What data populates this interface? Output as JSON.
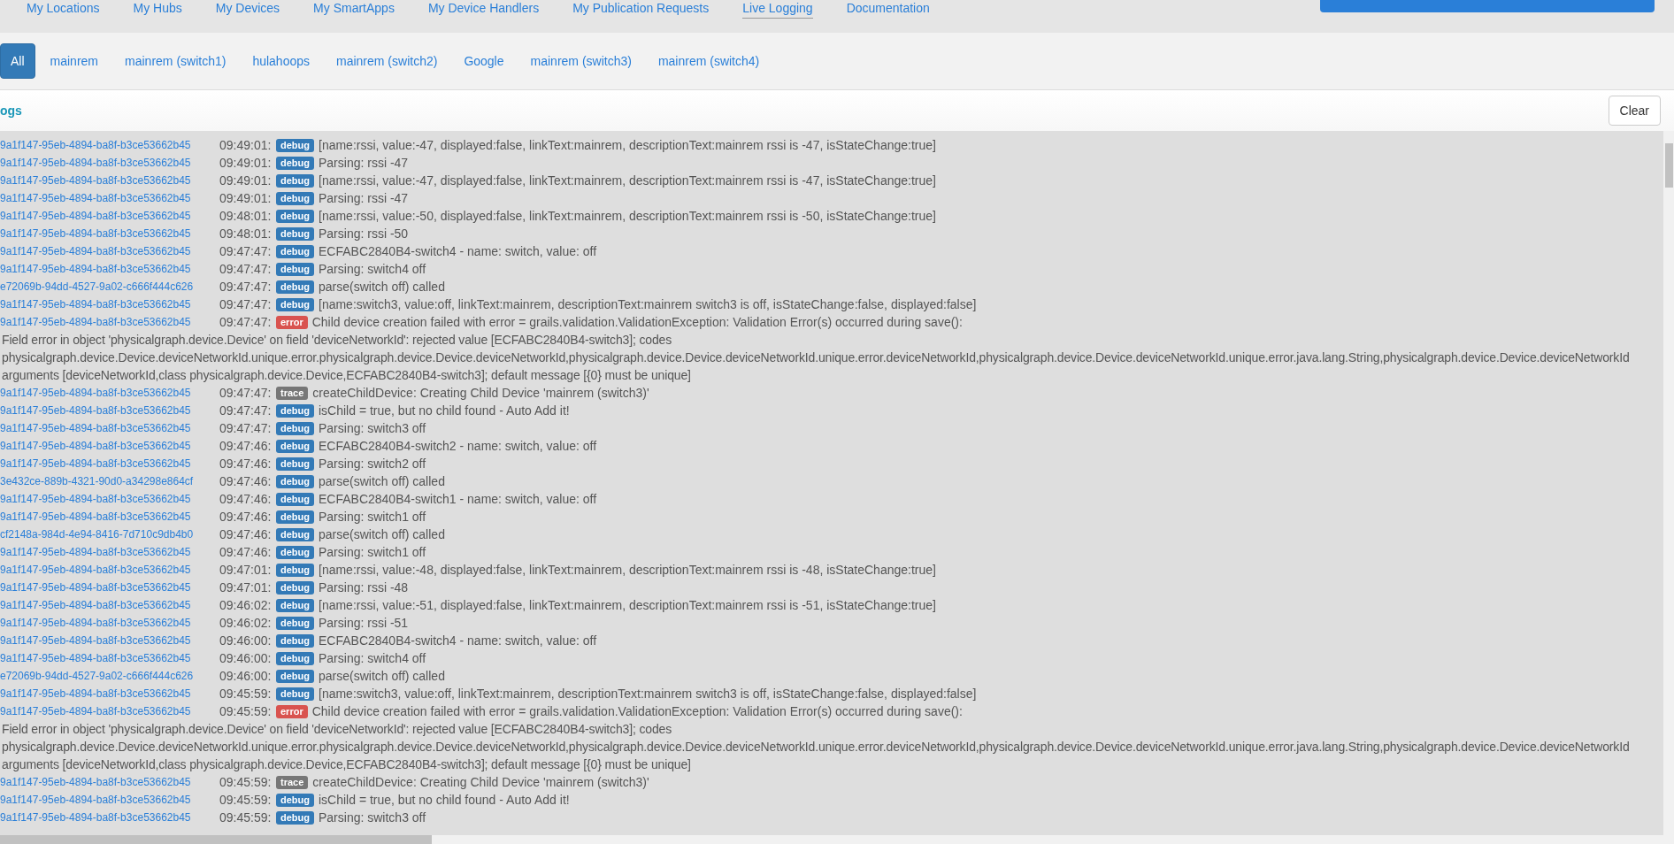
{
  "nav": [
    {
      "label": "My Locations",
      "selected": false
    },
    {
      "label": "My Hubs",
      "selected": false
    },
    {
      "label": "My Devices",
      "selected": false
    },
    {
      "label": "My SmartApps",
      "selected": false
    },
    {
      "label": "My Device Handlers",
      "selected": false
    },
    {
      "label": "My Publication Requests",
      "selected": false
    },
    {
      "label": "Live Logging",
      "selected": true
    },
    {
      "label": "Documentation",
      "selected": false
    }
  ],
  "filters": [
    {
      "label": "All",
      "selected": true
    },
    {
      "label": "mainrem",
      "selected": false
    },
    {
      "label": "mainrem (switch1)",
      "selected": false
    },
    {
      "label": "hulahoops",
      "selected": false
    },
    {
      "label": "mainrem (switch2)",
      "selected": false
    },
    {
      "label": "Google",
      "selected": false
    },
    {
      "label": "mainrem (switch3)",
      "selected": false
    },
    {
      "label": "mainrem (switch4)",
      "selected": false
    }
  ],
  "logs": {
    "title": "ogs",
    "clear_button": "Clear",
    "entries": [
      {
        "device": "9a1f147-95eb-4894-ba8f-b3ce53662b45",
        "time": "09:49:01:",
        "level": "debug",
        "message": "[name:rssi, value:-47, displayed:false, linkText:mainrem, descriptionText:mainrem rssi is -47, isStateChange:true]"
      },
      {
        "device": "9a1f147-95eb-4894-ba8f-b3ce53662b45",
        "time": "09:49:01:",
        "level": "debug",
        "message": "Parsing: rssi -47"
      },
      {
        "device": "9a1f147-95eb-4894-ba8f-b3ce53662b45",
        "time": "09:49:01:",
        "level": "debug",
        "message": "[name:rssi, value:-47, displayed:false, linkText:mainrem, descriptionText:mainrem rssi is -47, isStateChange:true]"
      },
      {
        "device": "9a1f147-95eb-4894-ba8f-b3ce53662b45",
        "time": "09:49:01:",
        "level": "debug",
        "message": "Parsing: rssi -47"
      },
      {
        "device": "9a1f147-95eb-4894-ba8f-b3ce53662b45",
        "time": "09:48:01:",
        "level": "debug",
        "message": "[name:rssi, value:-50, displayed:false, linkText:mainrem, descriptionText:mainrem rssi is -50, isStateChange:true]"
      },
      {
        "device": "9a1f147-95eb-4894-ba8f-b3ce53662b45",
        "time": "09:48:01:",
        "level": "debug",
        "message": "Parsing: rssi -50"
      },
      {
        "device": "9a1f147-95eb-4894-ba8f-b3ce53662b45",
        "time": "09:47:47:",
        "level": "debug",
        "message": "ECFABC2840B4-switch4 - name: switch, value: off"
      },
      {
        "device": "9a1f147-95eb-4894-ba8f-b3ce53662b45",
        "time": "09:47:47:",
        "level": "debug",
        "message": "Parsing: switch4 off"
      },
      {
        "device": "e72069b-94dd-4527-9a02-c666f444c626",
        "time": "09:47:47:",
        "level": "debug",
        "message": "parse(switch off) called"
      },
      {
        "device": "9a1f147-95eb-4894-ba8f-b3ce53662b45",
        "time": "09:47:47:",
        "level": "debug",
        "message": "[name:switch3, value:off, linkText:mainrem, descriptionText:mainrem switch3 is off, isStateChange:false, displayed:false]"
      },
      {
        "device": "9a1f147-95eb-4894-ba8f-b3ce53662b45",
        "time": "09:47:47:",
        "level": "error",
        "message": "Child device creation failed with error = grails.validation.ValidationException: Validation Error(s) occurred during save():",
        "details": [
          "Field error in object 'physicalgraph.device.Device' on field 'deviceNetworkId': rejected value [ECFABC2840B4-switch3]; codes",
          "physicalgraph.device.Device.deviceNetworkId.unique.error.physicalgraph.device.Device.deviceNetworkId,physicalgraph.device.Device.deviceNetworkId.unique.error.deviceNetworkId,physicalgraph.device.Device.deviceNetworkId.unique.error.java.lang.String,physicalgraph.device.Device.deviceNetworkId",
          "arguments [deviceNetworkId,class physicalgraph.device.Device,ECFABC2840B4-switch3]; default message [{0} must be unique]"
        ]
      },
      {
        "device": "9a1f147-95eb-4894-ba8f-b3ce53662b45",
        "time": "09:47:47:",
        "level": "trace",
        "message": "createChildDevice: Creating Child Device 'mainrem (switch3)'"
      },
      {
        "device": "9a1f147-95eb-4894-ba8f-b3ce53662b45",
        "time": "09:47:47:",
        "level": "debug",
        "message": "isChild = true, but no child found - Auto Add it!"
      },
      {
        "device": "9a1f147-95eb-4894-ba8f-b3ce53662b45",
        "time": "09:47:47:",
        "level": "debug",
        "message": "Parsing: switch3 off"
      },
      {
        "device": "9a1f147-95eb-4894-ba8f-b3ce53662b45",
        "time": "09:47:46:",
        "level": "debug",
        "message": "ECFABC2840B4-switch2 - name: switch, value: off"
      },
      {
        "device": "9a1f147-95eb-4894-ba8f-b3ce53662b45",
        "time": "09:47:46:",
        "level": "debug",
        "message": "Parsing: switch2 off"
      },
      {
        "device": "3e432ce-889b-4321-90d0-a34298e864cf",
        "time": "09:47:46:",
        "level": "debug",
        "message": "parse(switch off) called"
      },
      {
        "device": "9a1f147-95eb-4894-ba8f-b3ce53662b45",
        "time": "09:47:46:",
        "level": "debug",
        "message": "ECFABC2840B4-switch1 - name: switch, value: off"
      },
      {
        "device": "9a1f147-95eb-4894-ba8f-b3ce53662b45",
        "time": "09:47:46:",
        "level": "debug",
        "message": "Parsing: switch1 off"
      },
      {
        "device": "cf2148a-984d-4e94-8416-7d710c9db4b0",
        "time": "09:47:46:",
        "level": "debug",
        "message": "parse(switch off) called"
      },
      {
        "device": "9a1f147-95eb-4894-ba8f-b3ce53662b45",
        "time": "09:47:46:",
        "level": "debug",
        "message": "Parsing: switch1 off"
      },
      {
        "device": "9a1f147-95eb-4894-ba8f-b3ce53662b45",
        "time": "09:47:01:",
        "level": "debug",
        "message": "[name:rssi, value:-48, displayed:false, linkText:mainrem, descriptionText:mainrem rssi is -48, isStateChange:true]"
      },
      {
        "device": "9a1f147-95eb-4894-ba8f-b3ce53662b45",
        "time": "09:47:01:",
        "level": "debug",
        "message": "Parsing: rssi -48"
      },
      {
        "device": "9a1f147-95eb-4894-ba8f-b3ce53662b45",
        "time": "09:46:02:",
        "level": "debug",
        "message": "[name:rssi, value:-51, displayed:false, linkText:mainrem, descriptionText:mainrem rssi is -51, isStateChange:true]"
      },
      {
        "device": "9a1f147-95eb-4894-ba8f-b3ce53662b45",
        "time": "09:46:02:",
        "level": "debug",
        "message": "Parsing: rssi -51"
      },
      {
        "device": "9a1f147-95eb-4894-ba8f-b3ce53662b45",
        "time": "09:46:00:",
        "level": "debug",
        "message": "ECFABC2840B4-switch4 - name: switch, value: off"
      },
      {
        "device": "9a1f147-95eb-4894-ba8f-b3ce53662b45",
        "time": "09:46:00:",
        "level": "debug",
        "message": "Parsing: switch4 off"
      },
      {
        "device": "e72069b-94dd-4527-9a02-c666f444c626",
        "time": "09:46:00:",
        "level": "debug",
        "message": "parse(switch off) called"
      },
      {
        "device": "9a1f147-95eb-4894-ba8f-b3ce53662b45",
        "time": "09:45:59:",
        "level": "debug",
        "message": "[name:switch3, value:off, linkText:mainrem, descriptionText:mainrem switch3 is off, isStateChange:false, displayed:false]"
      },
      {
        "device": "9a1f147-95eb-4894-ba8f-b3ce53662b45",
        "time": "09:45:59:",
        "level": "error",
        "message": "Child device creation failed with error = grails.validation.ValidationException: Validation Error(s) occurred during save():",
        "details": [
          "Field error in object 'physicalgraph.device.Device' on field 'deviceNetworkId': rejected value [ECFABC2840B4-switch3]; codes",
          "physicalgraph.device.Device.deviceNetworkId.unique.error.physicalgraph.device.Device.deviceNetworkId,physicalgraph.device.Device.deviceNetworkId.unique.error.deviceNetworkId,physicalgraph.device.Device.deviceNetworkId.unique.error.java.lang.String,physicalgraph.device.Device.deviceNetworkId",
          "arguments [deviceNetworkId,class physicalgraph.device.Device,ECFABC2840B4-switch3]; default message [{0} must be unique]"
        ]
      },
      {
        "device": "9a1f147-95eb-4894-ba8f-b3ce53662b45",
        "time": "09:45:59:",
        "level": "trace",
        "message": "createChildDevice: Creating Child Device 'mainrem (switch3)'"
      },
      {
        "device": "9a1f147-95eb-4894-ba8f-b3ce53662b45",
        "time": "09:45:59:",
        "level": "debug",
        "message": "isChild = true, but no child found - Auto Add it!"
      },
      {
        "device": "9a1f147-95eb-4894-ba8f-b3ce53662b45",
        "time": "09:45:59:",
        "level": "debug",
        "message": "Parsing: switch3 off"
      }
    ]
  }
}
